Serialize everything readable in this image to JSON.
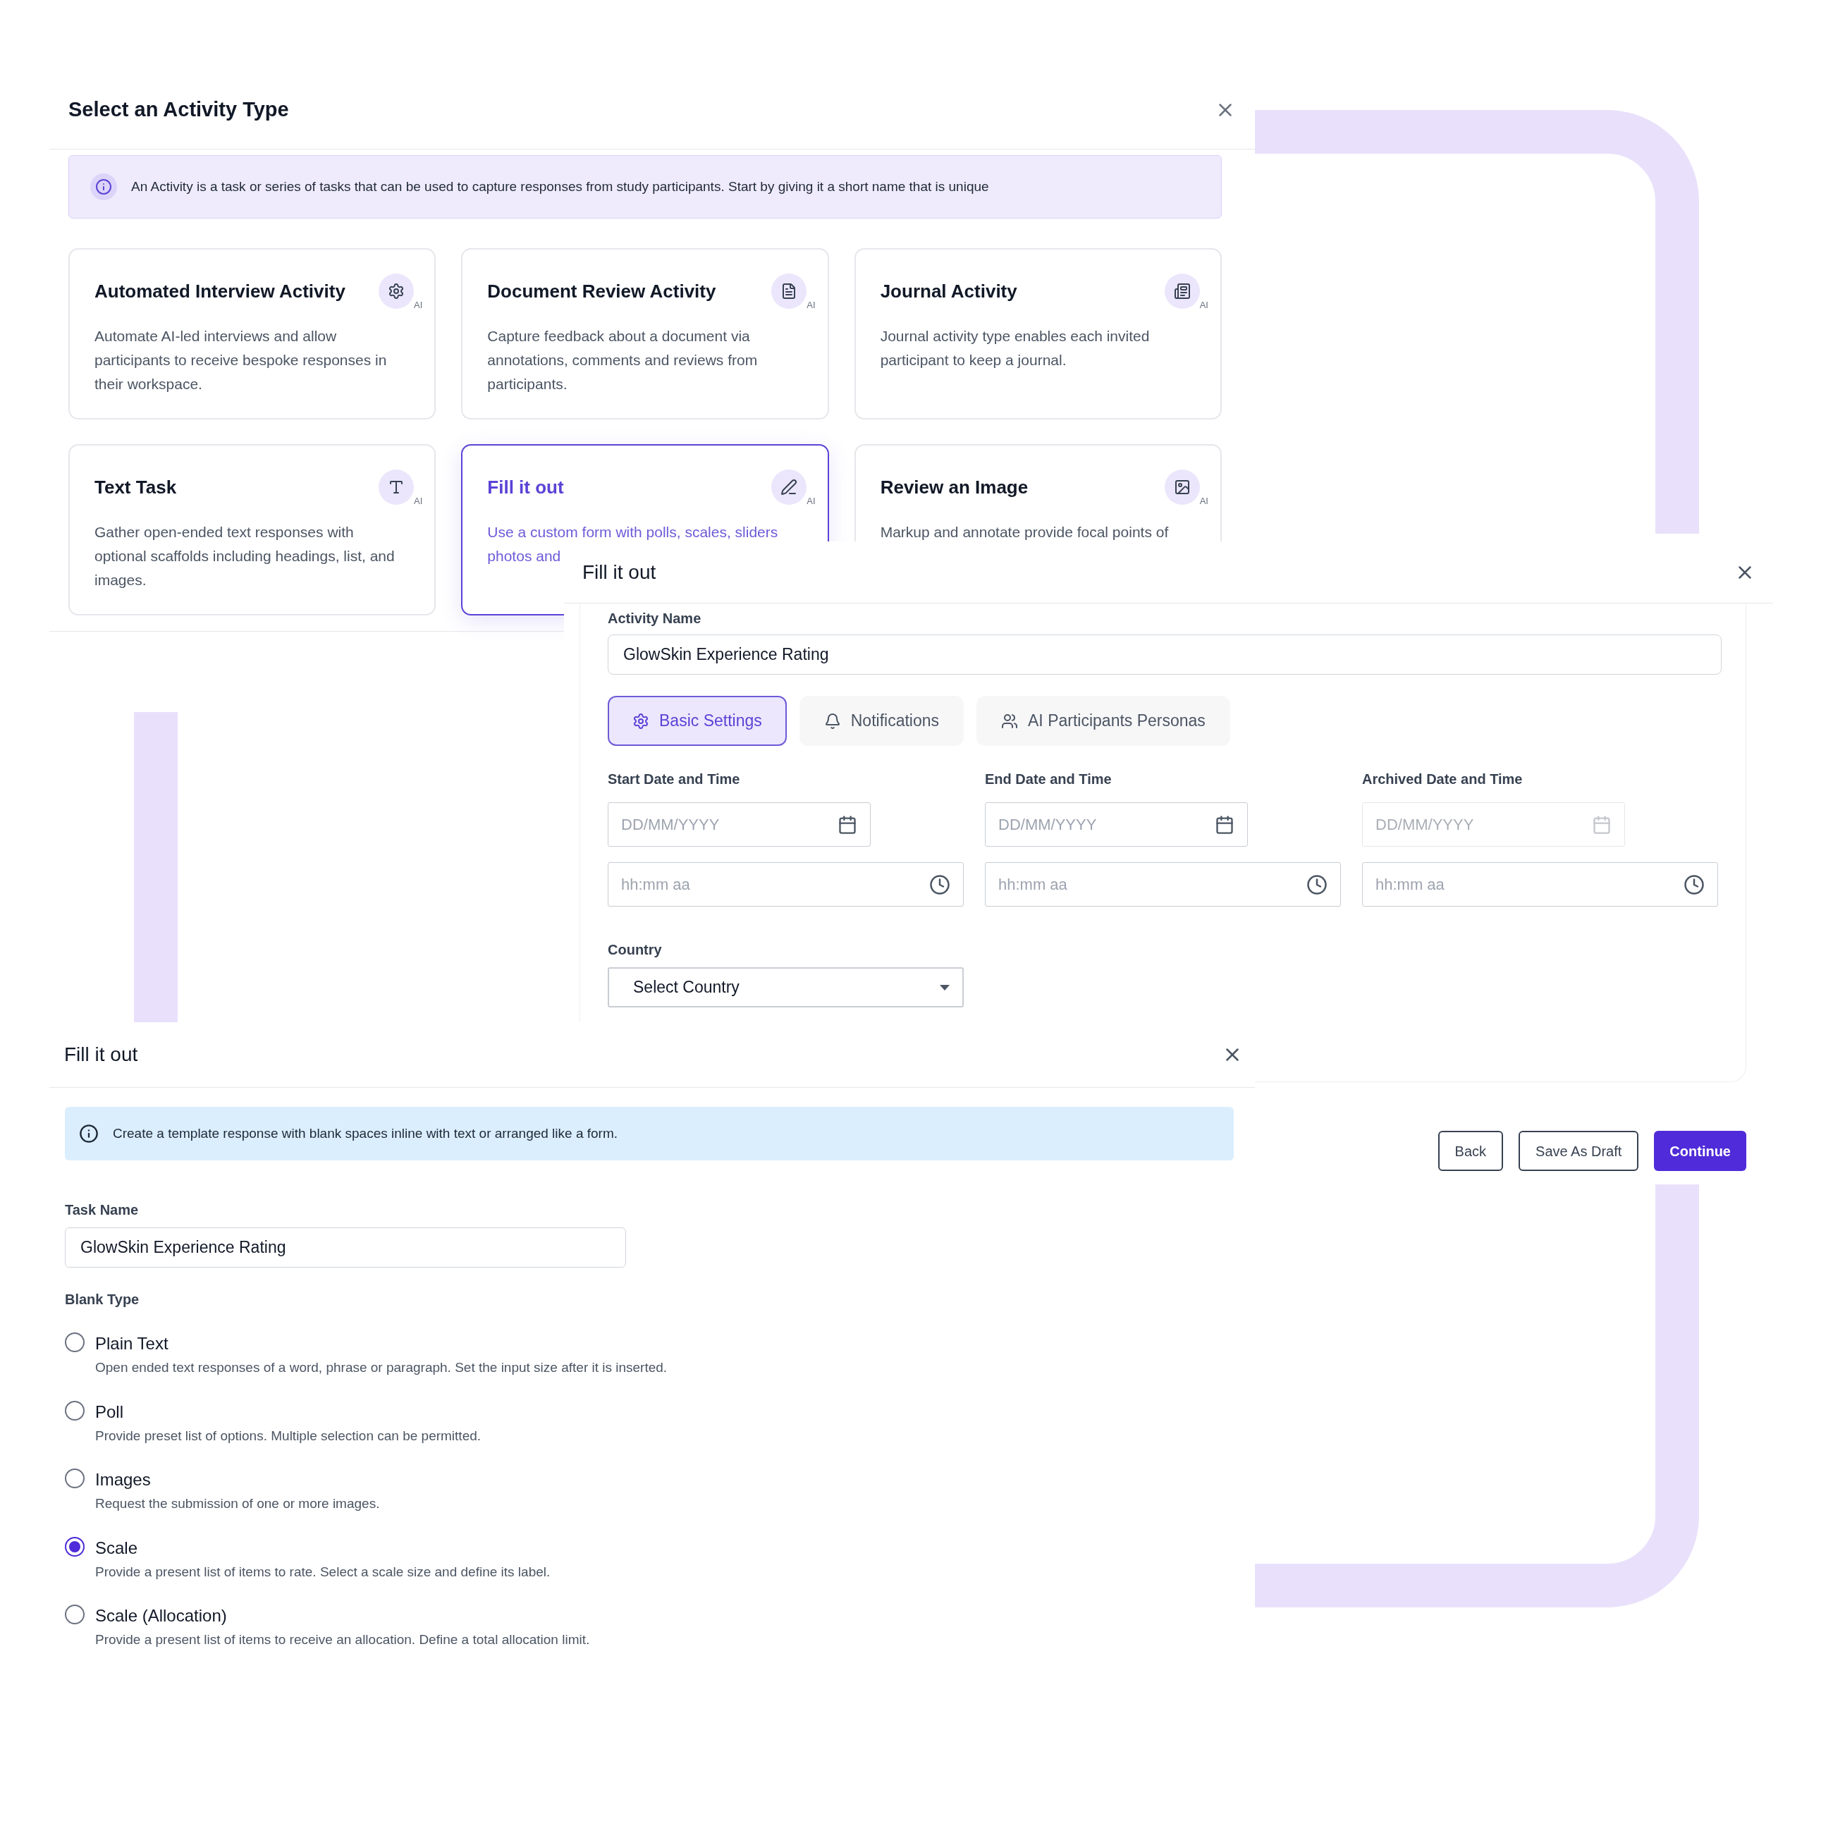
{
  "activity_type_dialog": {
    "title": "Select an Activity Type",
    "info": "An Activity is a task or series of tasks that can be used to capture responses from study participants. Start by giving it a short name that is unique",
    "cards": [
      {
        "title": "Automated Interview Activity",
        "description": "Automate AI-led interviews and allow participants to receive bespoke responses in their workspace.",
        "badge": "AI",
        "selected": false
      },
      {
        "title": "Document Review Activity",
        "description": "Capture feedback about a document via annotations, comments and reviews from participants.",
        "badge": "AI",
        "selected": false
      },
      {
        "title": "Journal Activity",
        "description": "Journal activity type enables each invited participant to keep a journal.",
        "badge": "AI",
        "selected": false
      },
      {
        "title": "Text Task",
        "description": "Gather open-ended text responses with optional scaffolds including headings, list, and images.",
        "badge": "AI",
        "selected": false
      },
      {
        "title": "Fill it out",
        "description": "Use a custom form with polls, scales, sliders photos and",
        "badge": "AI",
        "selected": true
      },
      {
        "title": "Review an Image",
        "description": "Markup and annotate provide focal points of",
        "badge": "AI",
        "selected": false
      }
    ]
  },
  "fill_dialog": {
    "title": "Fill it out",
    "activity_name": {
      "label": "Activity Name",
      "value": "GlowSkin Experience Rating"
    },
    "tabs": [
      {
        "label": "Basic Settings",
        "selected": true
      },
      {
        "label": "Notifications",
        "selected": false
      },
      {
        "label": "AI Participants Personas",
        "selected": false
      }
    ],
    "schedule": [
      {
        "label": "Start Date and Time",
        "date": {
          "placeholder": "DD/MM/YYYY",
          "disabled": false
        },
        "time": {
          "placeholder": "hh:mm aa"
        }
      },
      {
        "label": "End Date and Time",
        "date": {
          "placeholder": "DD/MM/YYYY",
          "disabled": false
        },
        "time": {
          "placeholder": "hh:mm aa"
        }
      },
      {
        "label": "Archived Date and Time",
        "date": {
          "placeholder": "DD/MM/YYYY",
          "disabled": true
        },
        "time": {
          "placeholder": "hh:mm aa"
        }
      }
    ],
    "country": {
      "label": "Country",
      "value": "Select Country"
    },
    "buttons": [
      {
        "label": "Back",
        "kind": "outline"
      },
      {
        "label": "Save As Draft",
        "kind": "outline"
      },
      {
        "label": "Continue",
        "kind": "primary"
      }
    ]
  },
  "blank_dialog": {
    "title": "Fill it out",
    "info": "Create a template response with blank spaces inline with text or arranged like a form.",
    "task_name": {
      "label": "Task Name",
      "value": "GlowSkin Experience Rating"
    },
    "blank_type": {
      "label": "Blank Type",
      "options": [
        {
          "label": "Plain Text",
          "description": "Open ended text responses of a word, phrase or paragraph. Set the input size after it is inserted.",
          "selected": false
        },
        {
          "label": "Poll",
          "description": "Provide preset list of options. Multiple selection can be permitted.",
          "selected": false
        },
        {
          "label": "Images",
          "description": "Request the submission of one or more images.",
          "selected": false
        },
        {
          "label": "Scale",
          "description": "Provide a present list of items to rate. Select a scale size and define its label.",
          "selected": true
        },
        {
          "label": "Scale (Allocation)",
          "description": "Provide a present list of items to receive an allocation. Define a total allocation limit.",
          "selected": false
        }
      ]
    }
  }
}
